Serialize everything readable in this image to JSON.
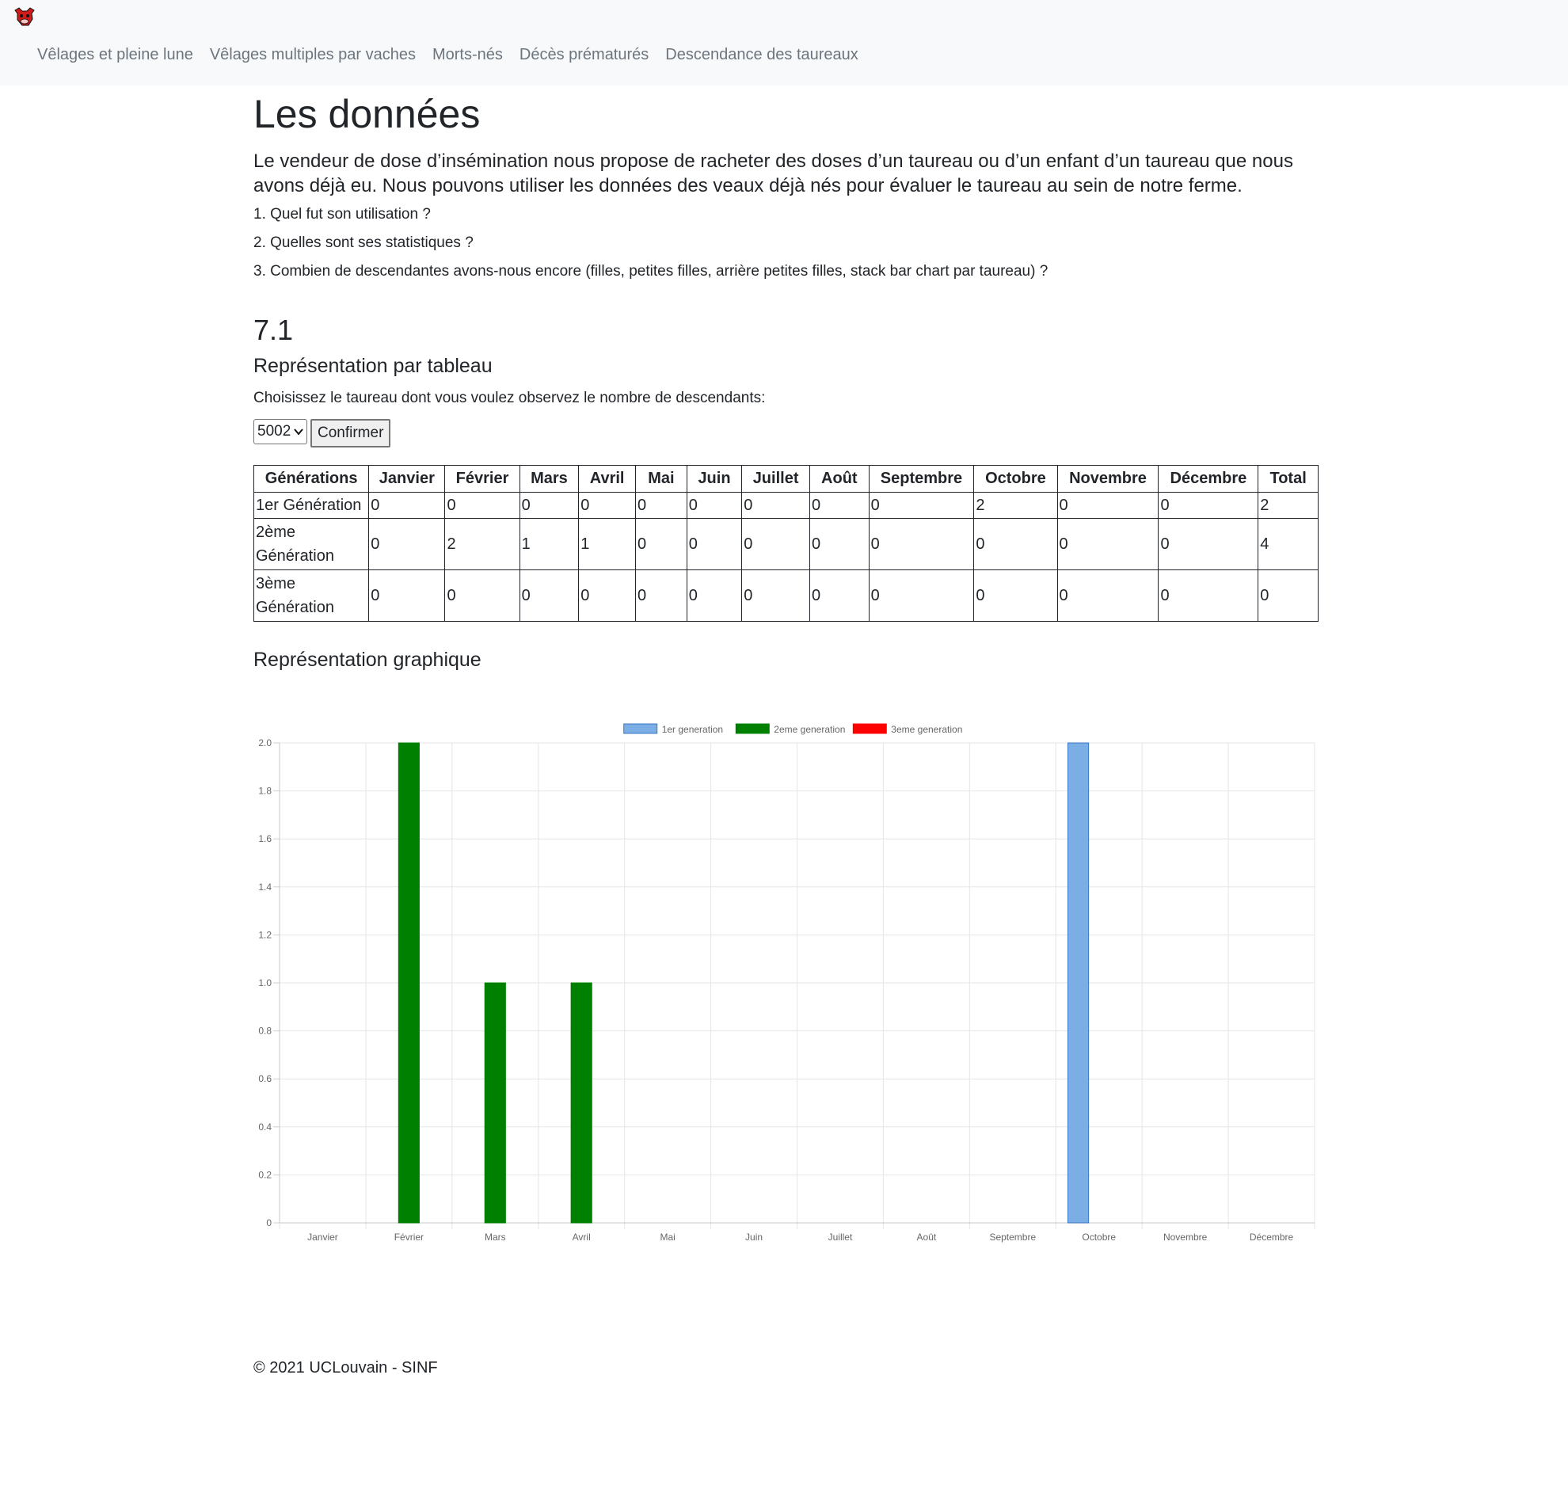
{
  "nav": {
    "items": [
      {
        "label": "Vêlages et pleine lune"
      },
      {
        "label": "Vêlages multiples par vaches"
      },
      {
        "label": "Morts-nés"
      },
      {
        "label": "Décès prématurés"
      },
      {
        "label": "Descendance des taureaux"
      }
    ]
  },
  "main": {
    "title": "Les données",
    "lead": "Le vendeur de dose d’insémination nous propose de racheter des doses d’un taureau ou d’un enfant d’un taureau que nous avons déjà eu. Nous pouvons utiliser les données des veaux déjà nés pour évaluer le taureau au sein de notre ferme.",
    "questions": [
      "1. Quel fut son utilisation ?",
      "2. Quelles sont ses statistiques ?",
      "3. Combien de descendantes avons-nous encore (filles, petites filles, arrière petites filles, stack bar chart par taureau) ?"
    ],
    "section_number": "7.1",
    "table_heading": "Représentation par tableau",
    "choose_text": "Choisissez le taureau dont vous voulez observez le nombre de descendants:",
    "select_value": "5002",
    "confirm_label": "Confirmer",
    "graph_heading": "Représentation graphique"
  },
  "table": {
    "headers": [
      "Générations",
      "Janvier",
      "Février",
      "Mars",
      "Avril",
      "Mai",
      "Juin",
      "Juillet",
      "Août",
      "Septembre",
      "Octobre",
      "Novembre",
      "Décembre",
      "Total"
    ],
    "rows": [
      [
        "1er Génération",
        "0",
        "0",
        "0",
        "0",
        "0",
        "0",
        "0",
        "0",
        "0",
        "2",
        "0",
        "0",
        "2"
      ],
      [
        "2ème Génération",
        "0",
        "2",
        "1",
        "1",
        "0",
        "0",
        "0",
        "0",
        "0",
        "0",
        "0",
        "0",
        "4"
      ],
      [
        "3ème Génération",
        "0",
        "0",
        "0",
        "0",
        "0",
        "0",
        "0",
        "0",
        "0",
        "0",
        "0",
        "0",
        "0"
      ]
    ]
  },
  "chart_data": {
    "type": "bar",
    "categories": [
      "Janvier",
      "Février",
      "Mars",
      "Avril",
      "Mai",
      "Juin",
      "Juillet",
      "Août",
      "Septembre",
      "Octobre",
      "Novembre",
      "Décembre"
    ],
    "series": [
      {
        "name": "1er generation",
        "color": "#7aaee4",
        "values": [
          0,
          0,
          0,
          0,
          0,
          0,
          0,
          0,
          0,
          2,
          0,
          0
        ]
      },
      {
        "name": "2eme generation",
        "color": "#008000",
        "values": [
          0,
          2,
          1,
          1,
          0,
          0,
          0,
          0,
          0,
          0,
          0,
          0
        ]
      },
      {
        "name": "3eme generation",
        "color": "#ff0000",
        "values": [
          0,
          0,
          0,
          0,
          0,
          0,
          0,
          0,
          0,
          0,
          0,
          0
        ]
      }
    ],
    "ylim": [
      0,
      2
    ],
    "yticks": [
      "0",
      "0.2",
      "0.4",
      "0.6",
      "0.8",
      "1.0",
      "1.2",
      "1.4",
      "1.6",
      "1.8",
      "2.0"
    ],
    "legend_position": "top-center",
    "grid": true
  },
  "footer": {
    "text": "© 2021 UCLouvain - SINF"
  }
}
